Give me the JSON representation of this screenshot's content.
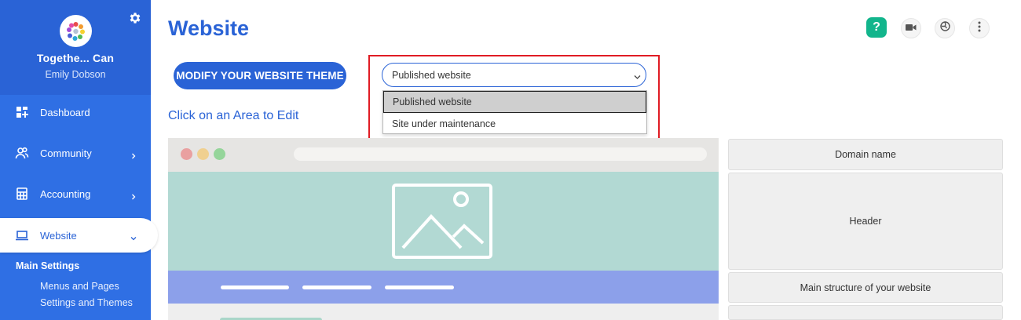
{
  "sidebar": {
    "org_name": "Togethe... Can",
    "user_name": "Emily Dobson",
    "items": [
      {
        "label": "Dashboard"
      },
      {
        "label": "Community"
      },
      {
        "label": "Accounting"
      },
      {
        "label": "Website"
      }
    ],
    "submenu": {
      "title": "Main Settings",
      "items": [
        {
          "label": "Menus and Pages"
        },
        {
          "label": "Settings and Themes"
        }
      ]
    }
  },
  "main": {
    "title": "Website",
    "modify_button": "MODIFY YOUR WEBSITE THEME",
    "status_select": {
      "value": "Published website",
      "options": [
        "Published website",
        "Site under maintenance"
      ]
    },
    "click_label": "Click on an Area to Edit",
    "help_label": "?",
    "areas": [
      {
        "label": "Domain name"
      },
      {
        "label": "Header"
      },
      {
        "label": "Main structure of your website"
      }
    ]
  },
  "colors": {
    "brand_blue": "#2a63d6",
    "sidebar_blue": "#2f6fe4",
    "help_green": "#12b58c",
    "highlight_red": "#e01c24",
    "hero_teal": "#b2d9d3",
    "nav_purple": "#8ca0ea"
  },
  "icons": {
    "settings": "gear-icon",
    "help": "help-icon",
    "video": "video-camera-icon",
    "globe": "globe-icon",
    "more": "more-vertical-icon"
  }
}
